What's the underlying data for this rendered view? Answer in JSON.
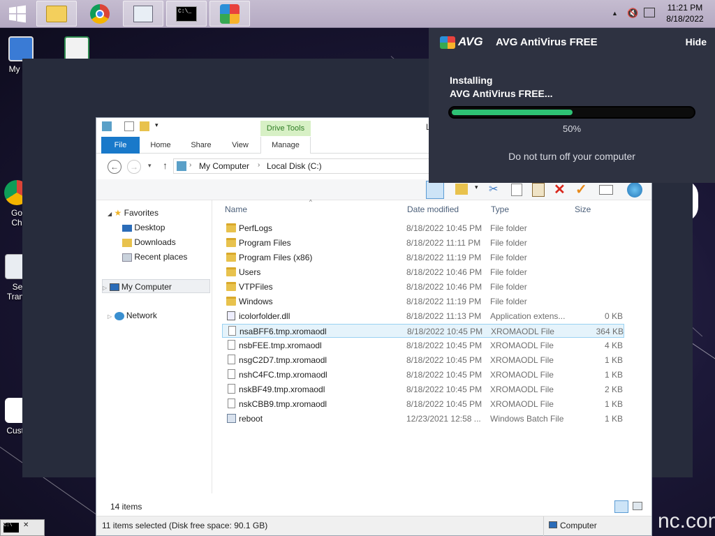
{
  "taskbar": {
    "time": "11:21 PM",
    "date": "8/18/2022"
  },
  "desktop": {
    "icons": [
      {
        "label": "My Co"
      },
      {
        "label": "Go"
      },
      {
        "label": "Ch"
      },
      {
        "label": "Se"
      },
      {
        "label": "Trans"
      },
      {
        "label": "Custo"
      }
    ],
    "watermark": "nc.com"
  },
  "explorer": {
    "drive_tools": "Drive Tools",
    "tabs": [
      "File",
      "Home",
      "Share",
      "View",
      "Manage"
    ],
    "title_fragment": "L",
    "breadcrumb": [
      "My Computer",
      "Local Disk (C:)"
    ],
    "nav": {
      "favorites": "Favorites",
      "desktop": "Desktop",
      "downloads": "Downloads",
      "recent": "Recent places",
      "computer": "My Computer",
      "network": "Network"
    },
    "columns": [
      "Name",
      "Date modified",
      "Type",
      "Size"
    ],
    "rows": [
      {
        "name": "PerfLogs",
        "date": "8/18/2022 10:45 PM",
        "type": "File folder",
        "size": "",
        "icon": "folder"
      },
      {
        "name": "Program Files",
        "date": "8/18/2022 11:11 PM",
        "type": "File folder",
        "size": "",
        "icon": "folder"
      },
      {
        "name": "Program Files (x86)",
        "date": "8/18/2022 11:19 PM",
        "type": "File folder",
        "size": "",
        "icon": "folder"
      },
      {
        "name": "Users",
        "date": "8/18/2022 10:46 PM",
        "type": "File folder",
        "size": "",
        "icon": "folder"
      },
      {
        "name": "VTPFiles",
        "date": "8/18/2022 10:46 PM",
        "type": "File folder",
        "size": "",
        "icon": "folder"
      },
      {
        "name": "Windows",
        "date": "8/18/2022 11:19 PM",
        "type": "File folder",
        "size": "",
        "icon": "folder"
      },
      {
        "name": "icolorfolder.dll",
        "date": "8/18/2022 11:13 PM",
        "type": "Application extens...",
        "size": "0 KB",
        "icon": "dll"
      },
      {
        "name": "nsaBFF6.tmp.xromaodl",
        "date": "8/18/2022 10:45 PM",
        "type": "XROMAODL File",
        "size": "364 KB",
        "icon": "doc",
        "selected": true
      },
      {
        "name": "nsbFEE.tmp.xromaodl",
        "date": "8/18/2022 10:45 PM",
        "type": "XROMAODL File",
        "size": "4 KB",
        "icon": "doc"
      },
      {
        "name": "nsgC2D7.tmp.xromaodl",
        "date": "8/18/2022 10:45 PM",
        "type": "XROMAODL File",
        "size": "1 KB",
        "icon": "doc"
      },
      {
        "name": "nshC4FC.tmp.xromaodl",
        "date": "8/18/2022 10:45 PM",
        "type": "XROMAODL File",
        "size": "1 KB",
        "icon": "doc"
      },
      {
        "name": "nskBF49.tmp.xromaodl",
        "date": "8/18/2022 10:45 PM",
        "type": "XROMAODL File",
        "size": "2 KB",
        "icon": "doc"
      },
      {
        "name": "nskCBB9.tmp.xromaodl",
        "date": "8/18/2022 10:45 PM",
        "type": "XROMAODL File",
        "size": "1 KB",
        "icon": "doc"
      },
      {
        "name": "reboot",
        "date": "12/23/2021 12:58 ...",
        "type": "Windows Batch File",
        "size": "1 KB",
        "icon": "bat"
      }
    ],
    "item_count": "14 items",
    "selection_status": "11 items selected (Disk free space: 90.1 GB)",
    "status_location": "Computer"
  },
  "avg": {
    "brand": "AVG",
    "title": "AVG AntiVirus FREE",
    "hide": "Hide",
    "line1": "Installing",
    "line2": "AVG AntiVirus FREE...",
    "progress": 0.5,
    "percent_label": "50%",
    "note": "Do not turn off your computer",
    "accent": "#2ec275"
  }
}
